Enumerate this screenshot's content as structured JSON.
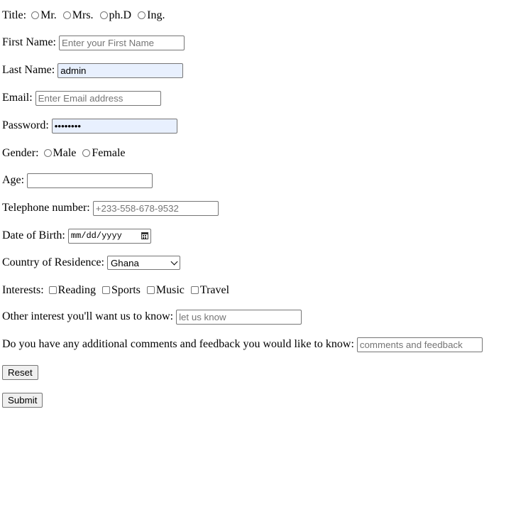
{
  "form": {
    "title": {
      "label": "Title:",
      "options": [
        "Mr.",
        "Mrs.",
        "ph.D",
        "Ing."
      ]
    },
    "first_name": {
      "label": "First Name:",
      "value": "",
      "placeholder": "Enter your First Name"
    },
    "last_name": {
      "label": "Last Name:",
      "value": "admin",
      "placeholder": ""
    },
    "email": {
      "label": "Email:",
      "value": "",
      "placeholder": "Enter Email address"
    },
    "password": {
      "label": "Password:",
      "value": "password",
      "placeholder": ""
    },
    "gender": {
      "label": "Gender:",
      "options": [
        "Male",
        "Female"
      ]
    },
    "age": {
      "label": "Age:",
      "value": ""
    },
    "telephone": {
      "label": "Telephone number:",
      "value": "",
      "placeholder": "+233-558-678-9532"
    },
    "dob": {
      "label": "Date of Birth:",
      "placeholder": "mm/dd/yyyy"
    },
    "country": {
      "label": "Country of Residence:",
      "selected": "Ghana"
    },
    "interests": {
      "label": "Interests:",
      "options": [
        "Reading",
        "Sports",
        "Music",
        "Travel"
      ]
    },
    "other_interest": {
      "label": "Other interest you'll want us to know:",
      "value": "",
      "placeholder": "let us know"
    },
    "comments": {
      "label": "Do you have any additional comments and feedback you would like to know:",
      "value": "",
      "placeholder": "comments and feedback"
    },
    "reset_label": "Reset",
    "submit_label": "Submit"
  }
}
